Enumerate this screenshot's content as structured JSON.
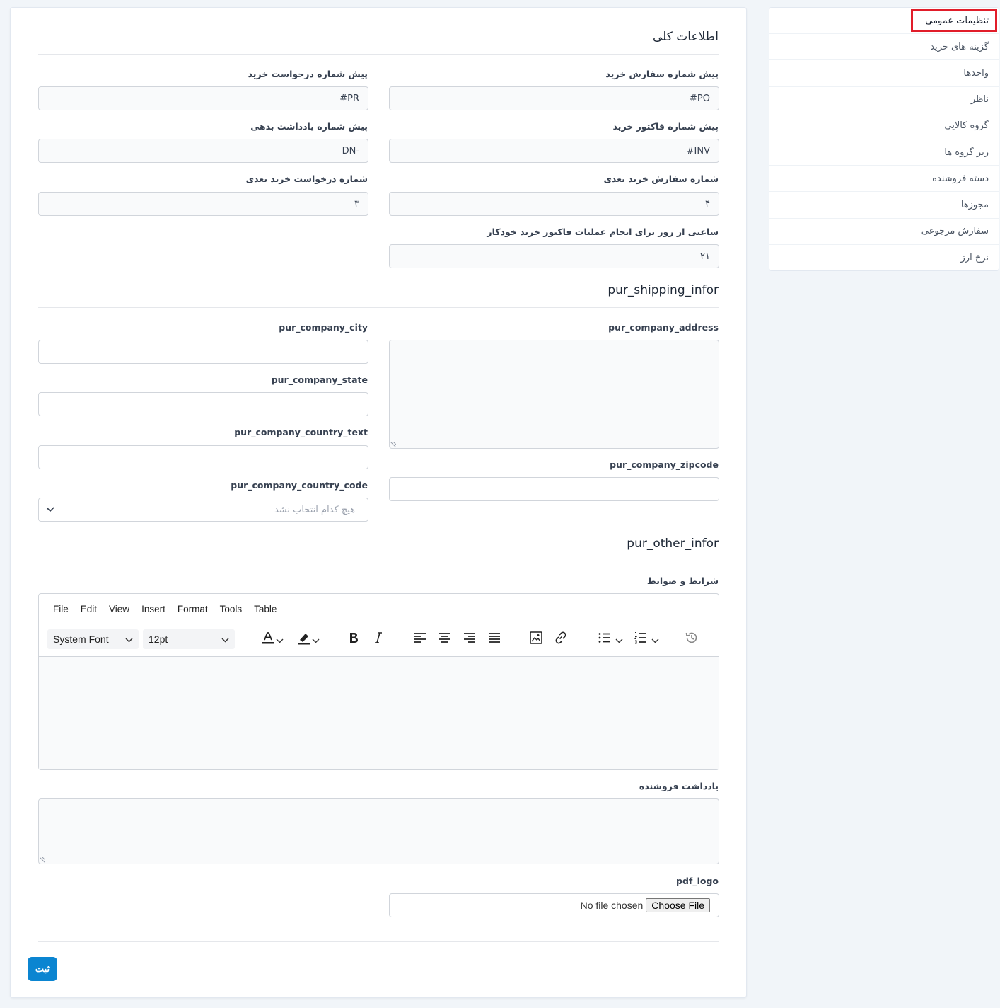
{
  "sidebar": {
    "items": [
      {
        "label": "تنظیمات عمومی"
      },
      {
        "label": "گزینه های خرید"
      },
      {
        "label": "واحدها"
      },
      {
        "label": "ناظر"
      },
      {
        "label": "گروه کالایی"
      },
      {
        "label": "زیر گروه ها"
      },
      {
        "label": "دسته فروشنده"
      },
      {
        "label": "مجوزها"
      },
      {
        "label": "سفارش مرجوعی"
      },
      {
        "label": "نرخ ارز"
      }
    ]
  },
  "general": {
    "title": "اطلاعات کلی",
    "po_prefix_label": "پیش شماره سفارش خرید",
    "po_prefix_value": "#PO",
    "pr_prefix_label": "پیش شماره درخواست خرید",
    "pr_prefix_value": "#PR",
    "inv_prefix_label": "پیش شماره فاکتور خرید",
    "inv_prefix_value": "#INV",
    "dn_prefix_label": "پیش شماره یادداشت بدهی",
    "dn_prefix_value": "DN-",
    "next_po_label": "شماره سفارش خرید بعدی",
    "next_po_value": "۴",
    "next_pr_label": "شماره درخواست خرید بعدی",
    "next_pr_value": "۳",
    "auto_invoice_hour_label": "ساعتی از روز برای انجام عملیات فاکتور خرید خودکار",
    "auto_invoice_hour_value": "۲۱"
  },
  "shipping": {
    "title": "pur_shipping_infor",
    "address_label": "pur_company_address",
    "city_label": "pur_company_city",
    "state_label": "pur_company_state",
    "country_text_label": "pur_company_country_text",
    "zipcode_label": "pur_company_zipcode",
    "country_code_label": "pur_company_country_code",
    "country_code_placeholder": "هیچ کدام انتخاب نشد"
  },
  "other": {
    "title": "pur_other_infor",
    "terms_label": "شرایط و ضوابط",
    "vendor_note_label": "یادداشت فروشنده",
    "pdf_logo_label": "pdf_logo",
    "file_status": "No file chosen",
    "choose_file": "Choose File"
  },
  "editor": {
    "menu": [
      "File",
      "Edit",
      "View",
      "Insert",
      "Format",
      "Tools",
      "Table"
    ],
    "font_family": "System Font",
    "font_size": "12pt"
  },
  "submit_label": "ثبت",
  "colors": {
    "primary": "#0b85d1",
    "highlight": "#e11d2a"
  }
}
